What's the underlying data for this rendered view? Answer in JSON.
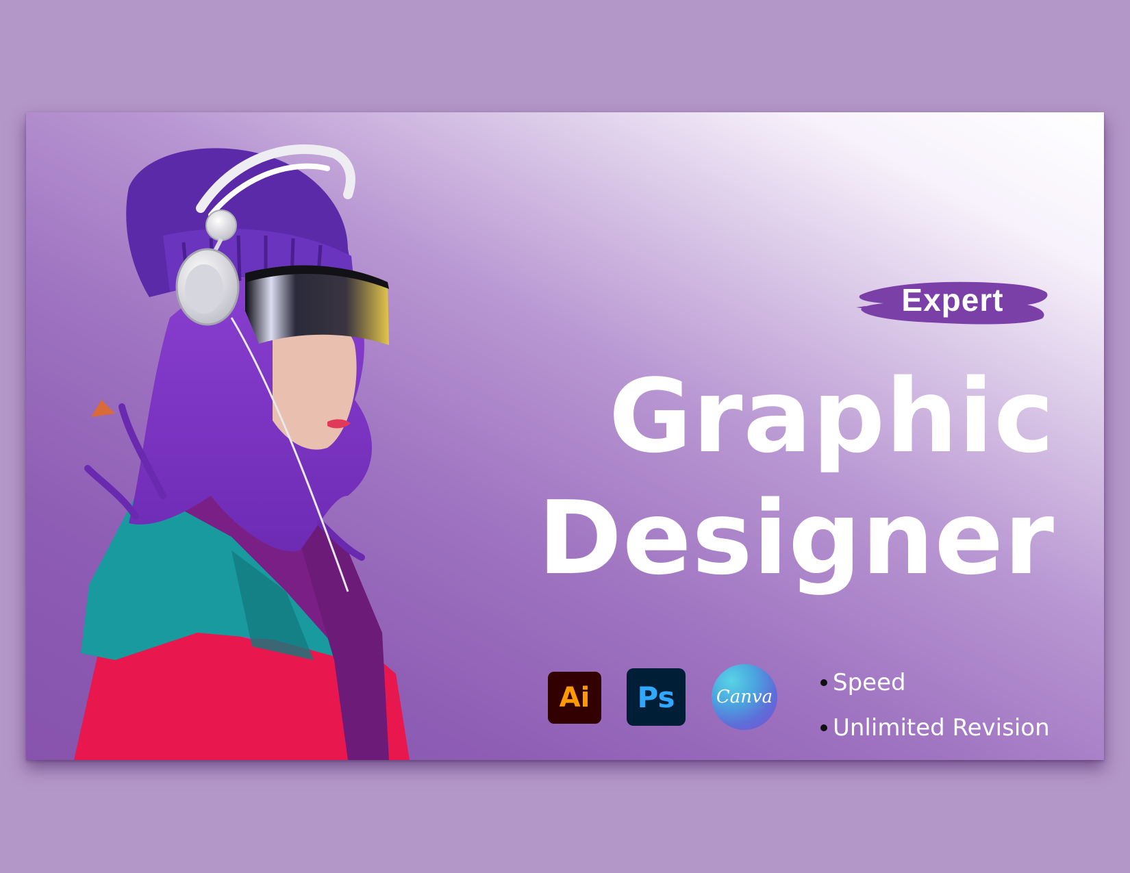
{
  "badge": {
    "label": "Expert",
    "color": "#7b3fa8"
  },
  "headline": {
    "line1": "Graphic",
    "line2": "Designer"
  },
  "tools": [
    {
      "icon": "illustrator-icon",
      "label": "Ai",
      "bg": "#330000",
      "fg": "#ff9a00"
    },
    {
      "icon": "photoshop-icon",
      "label": "Ps",
      "bg": "#001e36",
      "fg": "#31a8ff"
    },
    {
      "icon": "canva-icon",
      "label": "Canva"
    }
  ],
  "features": [
    "Speed",
    "Unlimited Revision"
  ],
  "colors": {
    "page_background": "#b397c8",
    "banner_purple": "#8753ad",
    "text": "#ffffff"
  }
}
